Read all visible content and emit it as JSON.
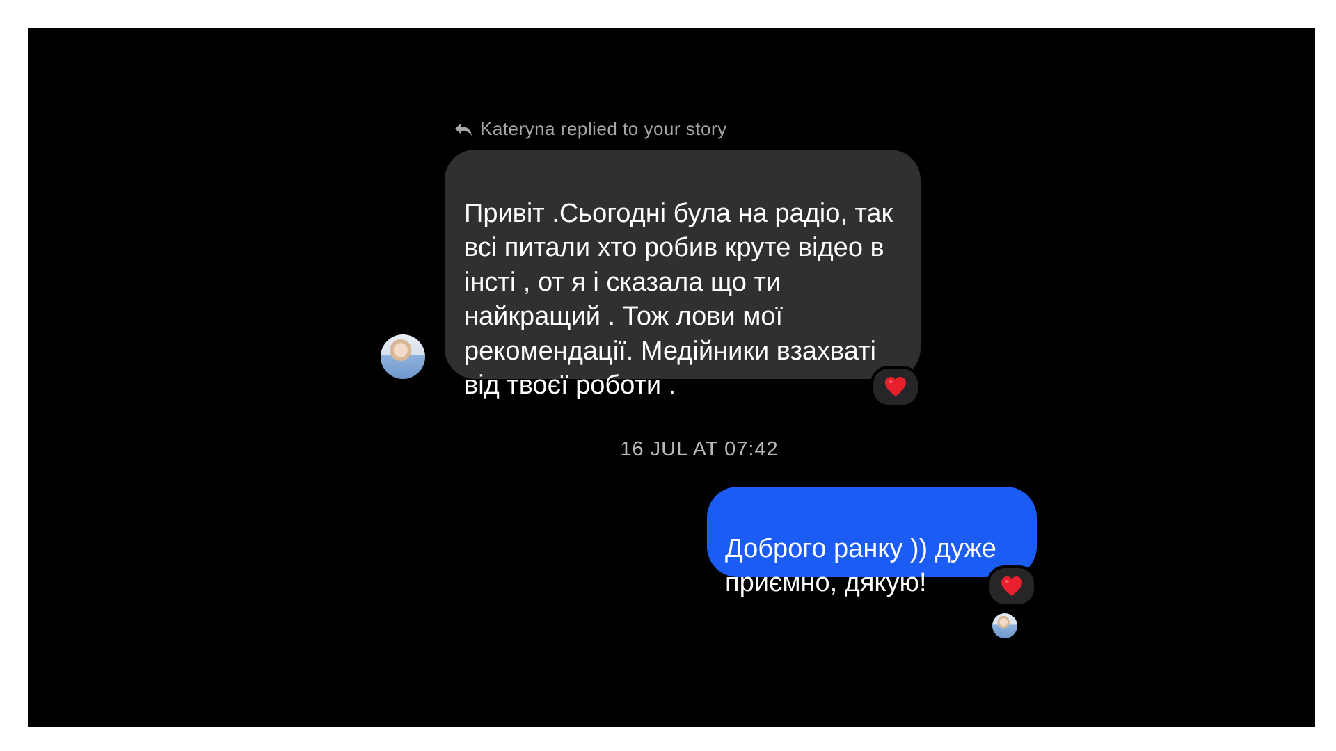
{
  "conversation": {
    "story_reply_header": "Kateryna replied to your story",
    "timestamp": "16 JUL AT 07:42",
    "messages": [
      {
        "direction": "incoming",
        "text": "Привіт .Сьогодні була на радіо, так\nвсі питали хто робив круте відео в\nінсті , от я і сказала що ти\nнайкращий . Тож лови мої\nрекомендації. Медійники взахваті\nвід твоєї роботи .",
        "reaction": "heart-icon"
      },
      {
        "direction": "outgoing",
        "text": "Доброго ранку )) дуже\nприємно, дякую!",
        "reaction": "heart-icon",
        "seen_avatar": true
      }
    ]
  },
  "colors": {
    "background": "#000000",
    "incoming_bubble": "#303032",
    "outgoing_bubble": "#1b5cf5",
    "reaction_bubble": "#262628",
    "heart": "#e8202e",
    "meta_text": "#a6a6aa"
  }
}
